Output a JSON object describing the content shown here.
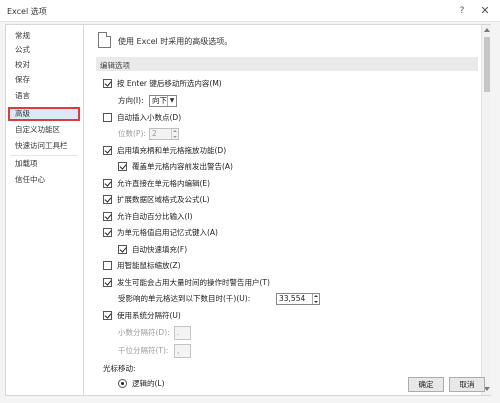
{
  "window": {
    "title": "Excel 选项",
    "help_glyph": "?",
    "close_glyph": "✕"
  },
  "sidebar": {
    "items": [
      {
        "label": "常规"
      },
      {
        "label": "公式"
      },
      {
        "label": "校对"
      },
      {
        "label": "保存"
      },
      {
        "label": "语言"
      },
      {
        "label": "高级"
      },
      {
        "label": "自定义功能区"
      },
      {
        "label": "快速访问工具栏"
      },
      {
        "label": "加载项"
      },
      {
        "label": "信任中心"
      }
    ],
    "selected": "高级"
  },
  "content": {
    "header": "使用 Excel 时采用的高级选项。",
    "section_title": "编辑选项",
    "options": {
      "move_after_enter": {
        "label": "按 Enter 键后移动所选内容(M)",
        "checked": true
      },
      "direction": {
        "label": "方向(I):",
        "value": "向下"
      },
      "auto_decimal": {
        "label": "自动插入小数点(D)",
        "checked": false
      },
      "places": {
        "label": "位数(P):",
        "value": "2"
      },
      "fill_handle": {
        "label": "启用填充柄和单元格拖放功能(D)",
        "checked": true
      },
      "alert_overwrite": {
        "label": "覆盖单元格内容前发出警告(A)",
        "checked": true
      },
      "edit_in_cell": {
        "label": "允许直接在单元格内编辑(E)",
        "checked": true
      },
      "extend_formats": {
        "label": "扩展数据区域格式及公式(L)",
        "checked": true
      },
      "auto_percent": {
        "label": "允许自动百分比输入(I)",
        "checked": true
      },
      "autocomplete": {
        "label": "为单元格值启用记忆式键入(A)",
        "checked": true
      },
      "flash_fill": {
        "label": "自动快速填充(F)",
        "checked": true
      },
      "intellimouse": {
        "label": "用智能鼠标缩放(Z)",
        "checked": false
      },
      "alert_slow": {
        "label": "发生可能会占用大量时间的操作时警告用户(T)",
        "checked": true
      },
      "cells_affected": {
        "label": "受影响的单元格达到以下数目时(千)(U):",
        "value": "33,554"
      },
      "system_separators": {
        "label": "使用系统分隔符(U)",
        "checked": true
      },
      "decimal_separator": {
        "label": "小数分隔符(D):",
        "value": "."
      },
      "thousands_separator": {
        "label": "千位分隔符(T):",
        "value": ","
      },
      "cursor_movement": {
        "label": "光标移动:"
      },
      "logical": {
        "label": "逻辑的(L)",
        "checked": true
      }
    }
  },
  "buttons": {
    "ok": "确定",
    "cancel": "取消"
  }
}
